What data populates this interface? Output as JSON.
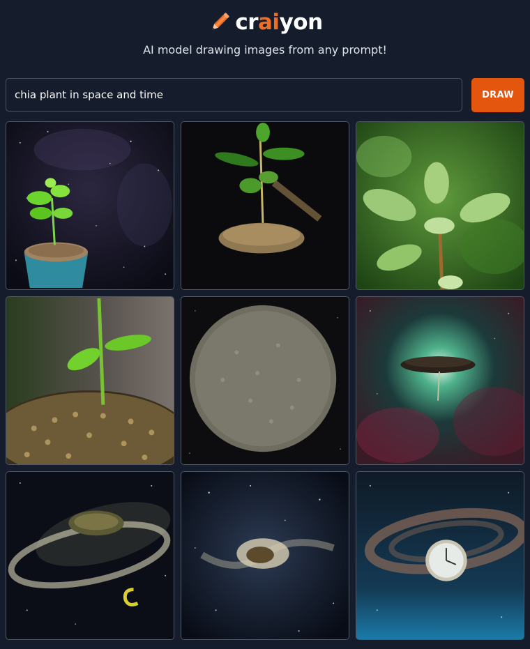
{
  "header": {
    "logo_prefix": "cr",
    "logo_highlight": "ai",
    "logo_suffix": "yon",
    "logo_icon": "pencil-icon",
    "tagline": "AI model drawing images from any prompt!"
  },
  "search": {
    "prompt_value": "chia plant in space and time",
    "draw_label": "DRAW"
  },
  "colors": {
    "background": "#151c2b",
    "accent": "#e4560d",
    "logo_ai": "#f26d21"
  },
  "results": [
    {
      "subject": "seedling in pot in space"
    },
    {
      "subject": "floating chia plant on dark background"
    },
    {
      "subject": "green leaves close-up"
    },
    {
      "subject": "sprout on seed mound"
    },
    {
      "subject": "round seed disc"
    },
    {
      "subject": "seed cloud in nebula"
    },
    {
      "subject": "seed galaxy swirl"
    },
    {
      "subject": "seed burst in starfield"
    },
    {
      "subject": "clock in galaxy swirl"
    }
  ]
}
